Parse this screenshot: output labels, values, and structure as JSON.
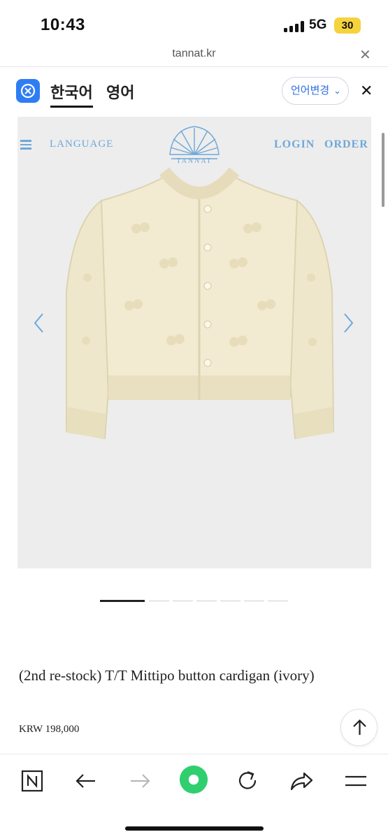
{
  "status_bar": {
    "time": "10:43",
    "network": "5G",
    "battery": "30",
    "battery_color": "#f5d33d"
  },
  "url_bar": {
    "url": "tannat.kr",
    "close_icon": "close-icon"
  },
  "translate_bar": {
    "tabs": [
      {
        "label": "한국어",
        "active": true
      },
      {
        "label": "영어",
        "active": false
      }
    ],
    "change_language": "언어변경",
    "accent": "#2f7df3"
  },
  "site_nav": {
    "language": "LANGUAGE",
    "login": "LOGIN",
    "order": "ORDER",
    "brand": "TANNAT",
    "accent": "#6fa8d8"
  },
  "gallery": {
    "image_alt": "ivory cardigan",
    "slides_total": 7,
    "current_slide": 1
  },
  "product": {
    "title": "(2nd re-stock) T/T Mittipo button cardigan (ivory)",
    "price": "KRW 198,000"
  },
  "toolbar": {
    "icons": [
      "naver-n-icon",
      "back-arrow-icon",
      "forward-arrow-icon",
      "home-circle-icon",
      "reload-icon",
      "share-icon",
      "menu-icon"
    ],
    "accent": "#2fcf6f"
  }
}
